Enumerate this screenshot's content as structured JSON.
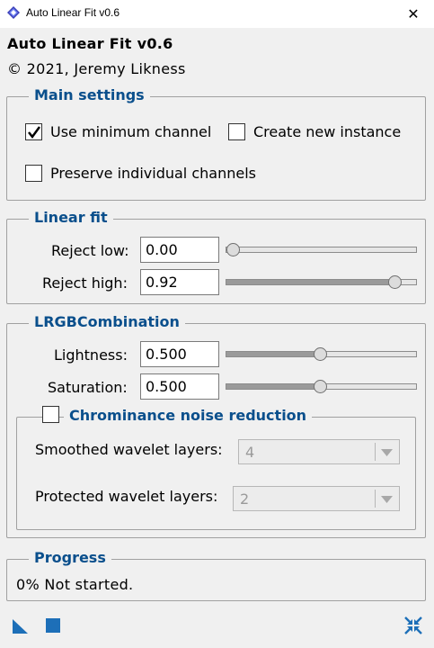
{
  "window": {
    "title": "Auto Linear Fit v0.6",
    "close_label": "✕"
  },
  "header": {
    "title": "Auto Linear Fit v0.6",
    "copyright": "© 2021, Jeremy Likness"
  },
  "main_settings": {
    "title": "Main settings",
    "use_min_channel": {
      "label": "Use minimum channel",
      "checked": true
    },
    "create_new_instance": {
      "label": "Create new instance",
      "checked": false
    },
    "preserve_channels": {
      "label": "Preserve individual channels",
      "checked": false
    }
  },
  "linear_fit": {
    "title": "Linear fit",
    "reject_low": {
      "label": "Reject low:",
      "value": "0.00",
      "slider_fraction": 0.0
    },
    "reject_high": {
      "label": "Reject high:",
      "value": "0.92",
      "slider_fraction": 0.92
    }
  },
  "lrgb": {
    "title": "LRGBCombination",
    "lightness": {
      "label": "Lightness:",
      "value": "0.500",
      "slider_fraction": 0.5
    },
    "saturation": {
      "label": "Saturation:",
      "value": "0.500",
      "slider_fraction": 0.5
    },
    "chrominance": {
      "title": "Chrominance noise reduction",
      "checked": false,
      "smoothed": {
        "label": "Smoothed wavelet layers:",
        "value": "4"
      },
      "protected": {
        "label": "Protected wavelet layers:",
        "value": "2"
      }
    }
  },
  "progress": {
    "title": "Progress",
    "status": "0% Not started."
  },
  "icons": {
    "app": "app-diamond-icon",
    "new_instance": "new-instance-triangle-icon",
    "execute": "execute-square-icon",
    "reset": "reset-arrows-icon"
  },
  "colors": {
    "accent": "#0a4f8c",
    "icon_blue": "#1d6fb8"
  }
}
